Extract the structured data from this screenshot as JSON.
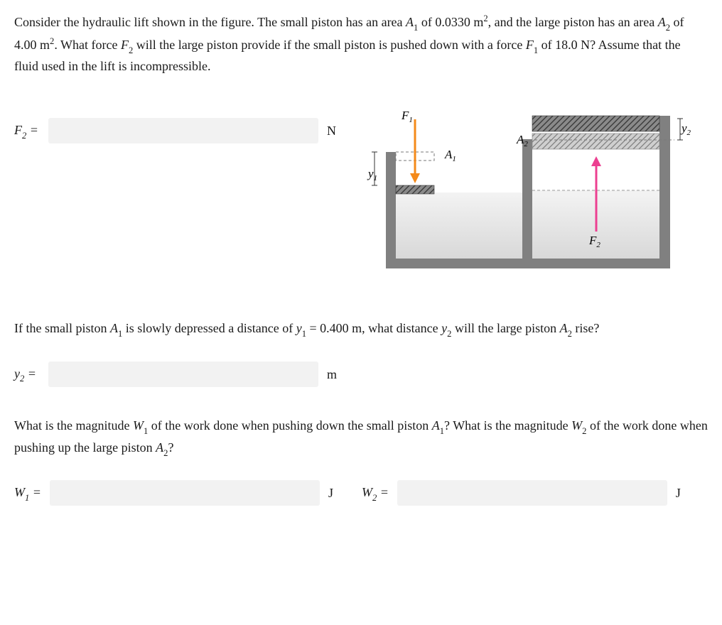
{
  "problem": {
    "intro_1": "Consider the hydraulic lift shown in the figure. The small piston has an area ",
    "A1": "A",
    "A1_sub": "1",
    "of_val1": " of 0.0330 m",
    "sq": "2",
    "intro_2": ", and the large piston has an area ",
    "A2": "A",
    "A2_sub": "2",
    "of_val2": " of 4.00 m",
    "intro_3": ". What force ",
    "F2": "F",
    "F2_sub": "2",
    "intro_4": " will the large piston provide if the small piston is pushed down with a force ",
    "F1": "F",
    "F1_sub": "1",
    "intro_5": " of 18.0 N? Assume that the fluid used in the lift is incompressible."
  },
  "answers": {
    "F2_label_var": "F",
    "F2_label_sub": "2",
    "eq": " = ",
    "F2_unit": "N",
    "y2_label_var": "y",
    "y2_label_sub": "2",
    "y2_unit": "m",
    "W1_label_var": "W",
    "W1_label_sub": "1",
    "W1_unit": "J",
    "W2_label_var": "W",
    "W2_label_sub": "2",
    "W2_unit": "J"
  },
  "figure": {
    "F1": "F",
    "F1_sub": "1",
    "A1": "A",
    "A1_sub": "1",
    "y1": "y",
    "y1_sub": "1",
    "A2": "A",
    "A2_sub": "2",
    "y2": "y",
    "y2_sub": "2",
    "F2": "F",
    "F2_sub": "2"
  },
  "question2": {
    "part1": "If the small piston ",
    "A1": "A",
    "A1_sub": "1",
    "part2": " is slowly depressed a distance of ",
    "y1": "y",
    "y1_sub": "1",
    "part3": " = 0.400 m, what distance ",
    "y2": "y",
    "y2_sub": "2",
    "part4": " will the large piston ",
    "A2": "A",
    "A2_sub": "2",
    "part5": " rise?"
  },
  "question3": {
    "part1": "What is the magnitude ",
    "W1": "W",
    "W1_sub": "1",
    "part2": " of the work done when pushing down the small piston ",
    "A1": "A",
    "A1_sub": "1",
    "part3": "? What is the magnitude ",
    "W2": "W",
    "W2_sub": "2",
    "part4": " of the work done when pushing up the large piston ",
    "A2": "A",
    "A2_sub": "2",
    "part5": "?"
  }
}
